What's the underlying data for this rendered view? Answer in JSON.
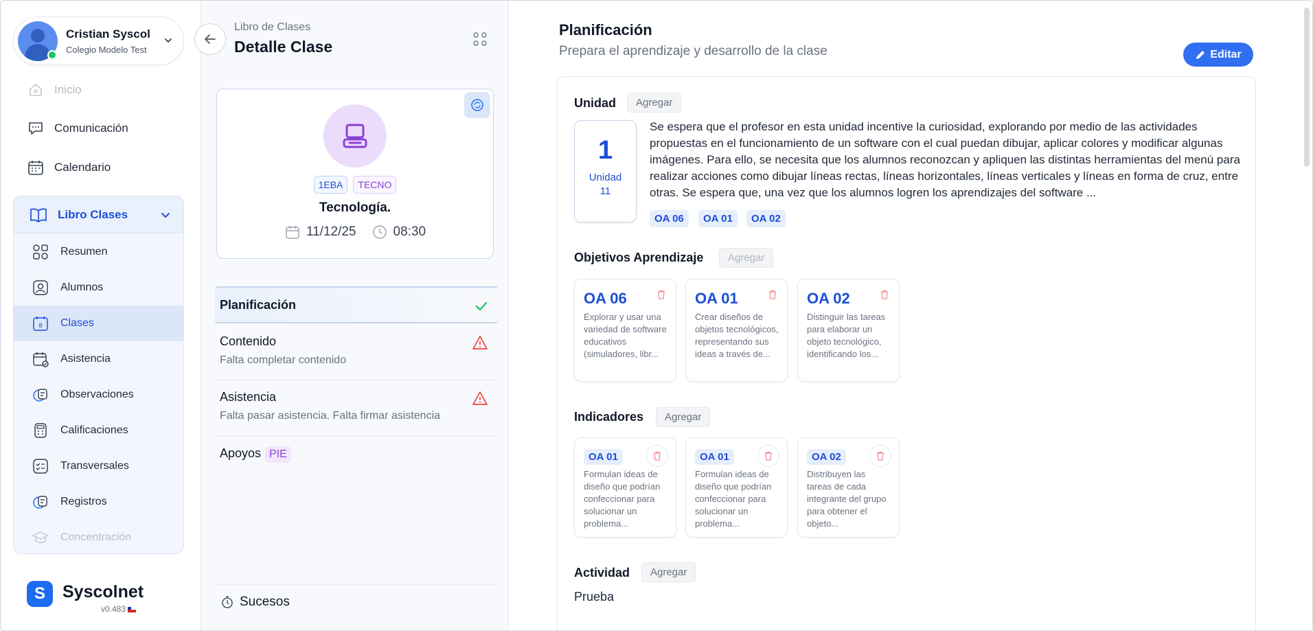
{
  "user": {
    "name": "Cristian Syscol",
    "school": "Colegio Modelo Test"
  },
  "nav": {
    "inicio": "Inicio",
    "comunicacion": "Comunicación",
    "calendario": "Calendario",
    "libro": "Libro Clases",
    "sub": [
      "Resumen",
      "Alumnos",
      "Clases",
      "Asistencia",
      "Observaciones",
      "Calificaciones",
      "Transversales",
      "Registros",
      "Concentración"
    ]
  },
  "brand": {
    "name": "Syscolnet",
    "version": "v0.483"
  },
  "header": {
    "crumb": "Libro de Clases",
    "title": "Detalle Clase"
  },
  "class_card": {
    "tags": [
      "1EBA",
      "TECNO"
    ],
    "name": "Tecnología.",
    "date": "11/12/25",
    "time": "08:30"
  },
  "steps": {
    "planificacion": "Planificación",
    "contenido": "Contenido",
    "contenido_sub": "Falta completar contenido",
    "asistencia": "Asistencia",
    "asistencia_sub": "Falta pasar asistencia. Falta firmar asistencia",
    "apoyos": "Apoyos",
    "apoyos_badge": "PIE",
    "sucesos": "Sucesos"
  },
  "main": {
    "title": "Planificación",
    "subtitle": "Prepara el aprendizaje y desarrollo de la clase",
    "edit": "Editar",
    "agregar": "Agregar",
    "unidad": {
      "title": "Unidad",
      "number": "1",
      "label": "Unidad",
      "sub": "11",
      "description": "Se espera que el profesor en esta unidad incentive la curiosidad, explorando por medio de las actividades propuestas en el funcionamiento de un software con el cual puedan dibujar, aplicar colores y modificar algunas imágenes. Para ello, se necesita que los alumnos reconozcan y apliquen las distintas herramientas del menú para realizar acciones como dibujar líneas rectas, líneas horizontales, líneas verticales y líneas en forma de cruz, entre otras. Se espera que, una vez que los alumnos logren los aprendizajes del software ...",
      "chips": [
        "OA 06",
        "OA 01",
        "OA 02"
      ]
    },
    "objetivos": {
      "title": "Objetivos Aprendizaje",
      "cards": [
        {
          "code": "OA 06",
          "desc": "Explorar y usar una variedad de software educativos (simuladores, libr..."
        },
        {
          "code": "OA 01",
          "desc": "Crear diseños de objetos tecnológicos, representando sus ideas a través de..."
        },
        {
          "code": "OA 02",
          "desc": "Distinguir las tareas para elaborar un objeto tecnológico, identificando los..."
        }
      ]
    },
    "indicadores": {
      "title": "Indicadores",
      "cards": [
        {
          "code": "OA 01",
          "desc": "Formulan ideas de diseño que podrían confeccionar para solucionar un problema..."
        },
        {
          "code": "OA 01",
          "desc": "Formulan ideas de diseño que podrían confeccionar para solucionar un problema..."
        },
        {
          "code": "OA 02",
          "desc": "Distribuyen las tareas de cada integrante del grupo para obtener el objeto..."
        }
      ]
    },
    "actividad": {
      "title": "Actividad",
      "text": "Prueba"
    }
  },
  "colors": {
    "accent": "#2f6ff0",
    "brand": "#1d6cf0",
    "success": "#22c55e",
    "warning": "#ef4444",
    "purple": "#8b3fd6"
  }
}
